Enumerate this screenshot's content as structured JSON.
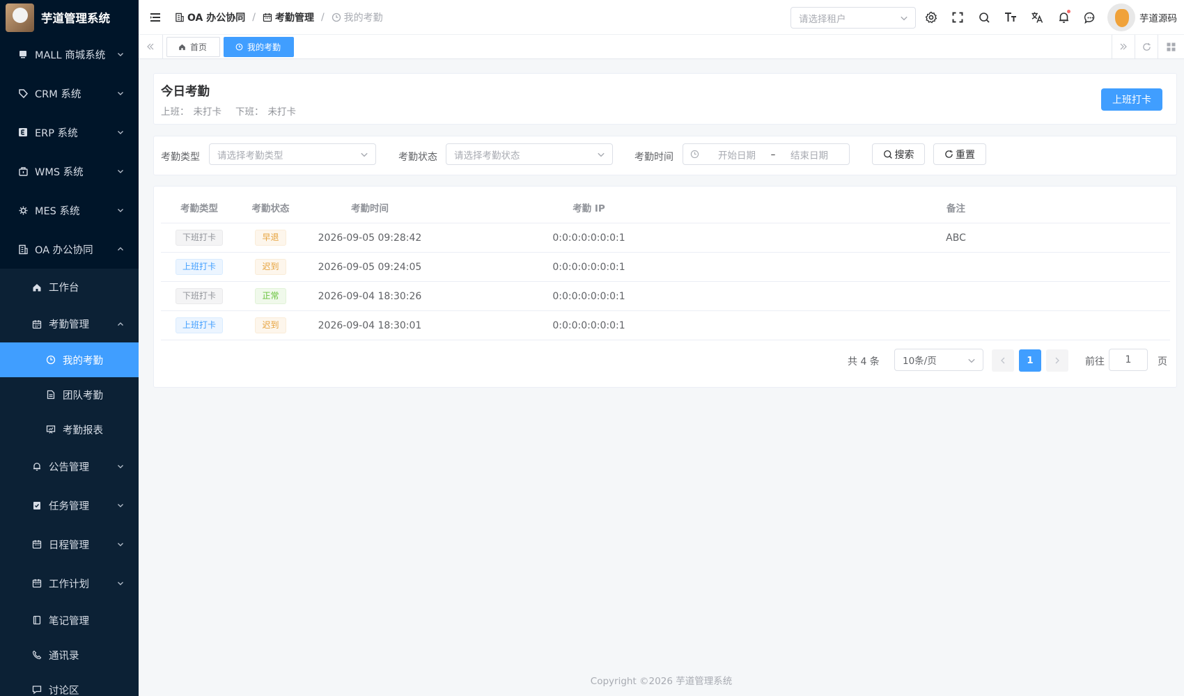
{
  "app": {
    "title": "芋道管理系统"
  },
  "sidebar": {
    "items": [
      {
        "label": "MALL 商城系统",
        "icon": "shop-icon"
      },
      {
        "label": "CRM 系统",
        "icon": "tag-icon"
      },
      {
        "label": "ERP 系统",
        "icon": "erp-icon"
      },
      {
        "label": "WMS 系统",
        "icon": "box-icon"
      },
      {
        "label": "MES 系统",
        "icon": "cog-icon"
      },
      {
        "label": "OA 办公协同",
        "icon": "building-icon"
      }
    ],
    "oa_children": [
      {
        "label": "工作台",
        "icon": "home-icon"
      },
      {
        "label": "考勤管理",
        "icon": "calendar-icon"
      }
    ],
    "attendance_children": [
      {
        "label": "我的考勤",
        "icon": "clock-icon"
      },
      {
        "label": "团队考勤",
        "icon": "document-icon"
      },
      {
        "label": "考勤报表",
        "icon": "chart-icon"
      }
    ],
    "oa_more": [
      {
        "label": "公告管理",
        "icon": "bell-icon"
      },
      {
        "label": "任务管理",
        "icon": "clipboard-icon"
      },
      {
        "label": "日程管理",
        "icon": "calendar-icon"
      },
      {
        "label": "工作计划",
        "icon": "calendar-icon"
      },
      {
        "label": "笔记管理",
        "icon": "notebook-icon"
      },
      {
        "label": "通讯录",
        "icon": "phone-icon"
      },
      {
        "label": "讨论区",
        "icon": "chat-icon"
      }
    ]
  },
  "header": {
    "breadcrumb": [
      "OA 办公协同",
      "考勤管理",
      "我的考勤"
    ],
    "tenant_placeholder": "请选择租户",
    "username": "芋道源码"
  },
  "tags": {
    "home": "首页",
    "current": "我的考勤"
  },
  "today": {
    "title": "今日考勤",
    "checkin_label": "上班：",
    "checkin_value": "未打卡",
    "checkout_label": "下班：",
    "checkout_value": "未打卡",
    "clock_button": "上班打卡"
  },
  "filters": {
    "type_label": "考勤类型",
    "type_placeholder": "请选择考勤类型",
    "status_label": "考勤状态",
    "status_placeholder": "请选择考勤状态",
    "time_label": "考勤时间",
    "start_placeholder": "开始日期",
    "range_sep": "–",
    "end_placeholder": "结束日期",
    "search_button": "搜索",
    "reset_button": "重置"
  },
  "table": {
    "headers": [
      "考勤类型",
      "考勤状态",
      "考勤时间",
      "考勤 IP",
      "备注"
    ],
    "rows": [
      {
        "type": "下班打卡",
        "type_style": "info",
        "status": "早退",
        "status_style": "warning",
        "time": "2026-09-05 09:28:42",
        "ip": "0:0:0:0:0:0:0:1",
        "remark": "ABC"
      },
      {
        "type": "上班打卡",
        "type_style": "primary",
        "status": "迟到",
        "status_style": "warning",
        "time": "2026-09-05 09:24:05",
        "ip": "0:0:0:0:0:0:0:1",
        "remark": ""
      },
      {
        "type": "下班打卡",
        "type_style": "info",
        "status": "正常",
        "status_style": "success",
        "time": "2026-09-04 18:30:26",
        "ip": "0:0:0:0:0:0:0:1",
        "remark": ""
      },
      {
        "type": "上班打卡",
        "type_style": "primary",
        "status": "迟到",
        "status_style": "warning",
        "time": "2026-09-04 18:30:01",
        "ip": "0:0:0:0:0:0:0:1",
        "remark": ""
      }
    ]
  },
  "pagination": {
    "total_text": "共 4 条",
    "page_size": "10条/页",
    "current_page": "1",
    "goto_label": "前往",
    "goto_value": "1",
    "page_suffix": "页"
  },
  "footer": {
    "copyright": "Copyright ©2026 芋道管理系统"
  },
  "colors": {
    "primary": "#409eff",
    "sidebar_bg": "#001529",
    "warning": "#e6a23c",
    "success": "#67c23a"
  }
}
